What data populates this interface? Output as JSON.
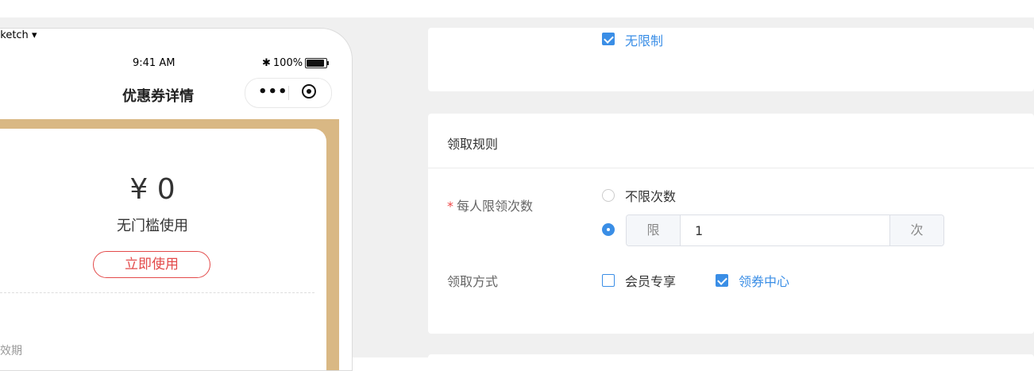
{
  "phone": {
    "status_carrier": "Sketch",
    "status_time": "9:41 AM",
    "status_battery": "100%",
    "nav_title": "优惠券详情",
    "capsule_more": "•••",
    "coupon_price": "¥ 0",
    "coupon_threshold": "无门槛使用",
    "use_button": "立即使用",
    "validity_label": "有效期"
  },
  "form": {
    "unlimited_label": "无限制",
    "section_title": "领取规则",
    "limit_label": "每人限领次数",
    "required_mark": "*",
    "option_unlimited": "不限次数",
    "limit_prefix": "限",
    "limit_value": "1",
    "limit_suffix": "次",
    "method_label": "领取方式",
    "method_member": "会员专享",
    "method_center": "领券中心"
  },
  "colors": {
    "accent": "#3a8ee6",
    "danger": "#e34a4a",
    "gold": "#d9b884"
  }
}
